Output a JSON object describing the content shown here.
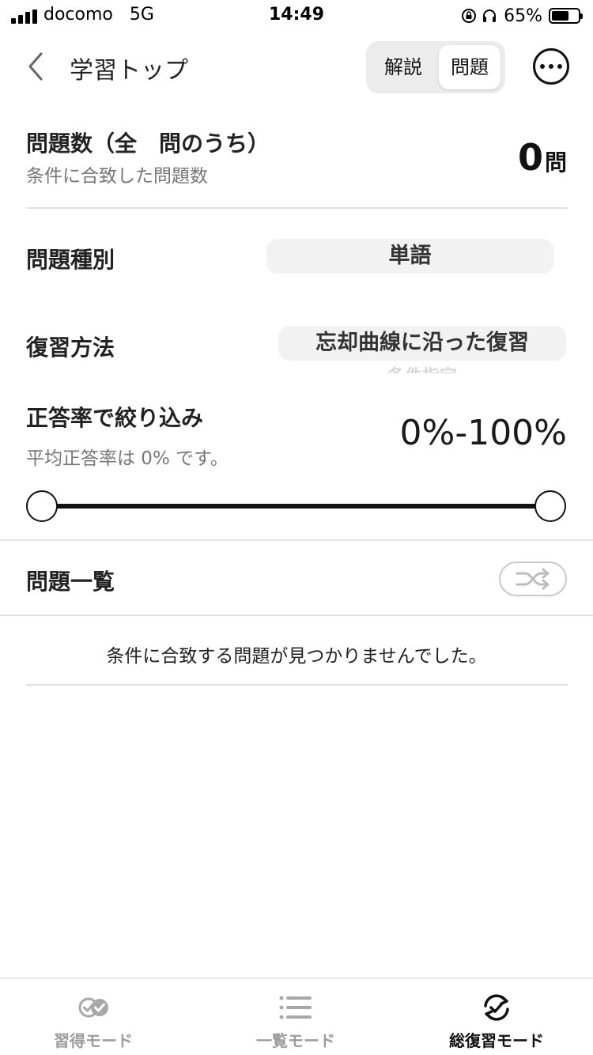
{
  "status_bar": {
    "carrier": "docomo",
    "network": "5G",
    "time": "14:49",
    "battery_percent": "65%",
    "battery_level": 0.65
  },
  "nav": {
    "back_label": "学習トップ",
    "segments": [
      "解説",
      "問題"
    ],
    "selected_segment": "問題"
  },
  "summary": {
    "title": "問題数（全　問のうち）",
    "subtitle": "条件に合致した問題数",
    "count": "0",
    "unit": "問"
  },
  "question_type": {
    "label": "問題種別",
    "value": "単語"
  },
  "review_method": {
    "label": "復習方法",
    "options": [
      "忘却曲線に沿った復習",
      "条件指定"
    ],
    "selected": "忘却曲線に沿った復習"
  },
  "accuracy_filter": {
    "label": "正答率で絞り込み",
    "subtitle": "平均正答率は 0% です。",
    "range_text": "0%-100%",
    "min": 0,
    "max": 100
  },
  "question_list": {
    "title": "問題一覧",
    "empty_message": "条件に合致する問題が見つかりませんでした。"
  },
  "tab_bar": {
    "tabs": [
      {
        "label": "習得モード",
        "icon": "double-check-icon",
        "active": false
      },
      {
        "label": "一覧モード",
        "icon": "list-icon",
        "active": false
      },
      {
        "label": "総復習モード",
        "icon": "sync-check-icon",
        "active": true
      }
    ]
  },
  "colors": {
    "primary_text": "#1a1a1a",
    "muted_text": "#777777",
    "pill_bg": "#f2f2f2",
    "inactive_tab": "#9c9c9c",
    "divider": "#e2e2e2"
  }
}
